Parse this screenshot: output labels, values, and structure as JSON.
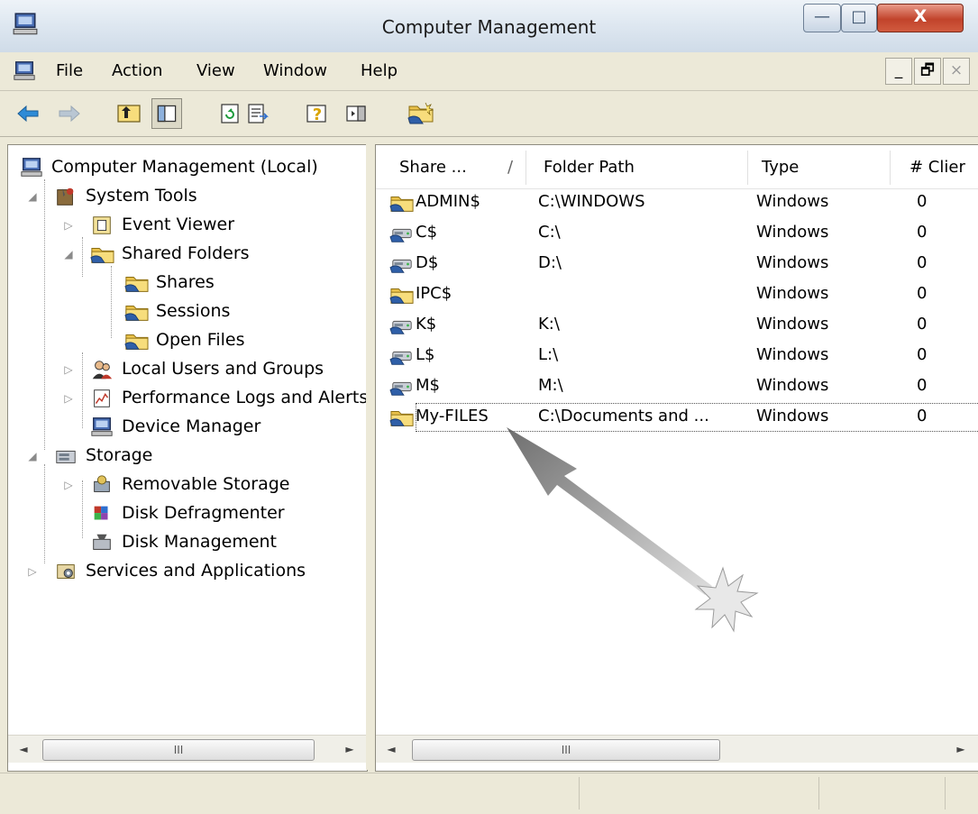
{
  "window": {
    "title": "Computer Management",
    "caption_buttons": {
      "minimize": "—",
      "maximize": "□",
      "close": "X"
    }
  },
  "menu": {
    "items": [
      {
        "label": "File"
      },
      {
        "label": "Action"
      },
      {
        "label": "View"
      },
      {
        "label": "Window"
      },
      {
        "label": "Help"
      }
    ],
    "mdi_buttons": {
      "minimize": "_",
      "restore": "🗗",
      "close": "×"
    }
  },
  "toolbar": {
    "buttons": [
      "back-arrow-icon",
      "forward-arrow-icon",
      "up-one-level-icon",
      "show-hide-console-tree-icon",
      "refresh-icon",
      "export-list-icon",
      "help-icon",
      "show-hide-action-pane-icon",
      "share-wizard-icon"
    ]
  },
  "tree": {
    "items": [
      {
        "label": "Computer Management (Local)",
        "icon": "computer-icon"
      },
      {
        "label": "System Tools",
        "icon": "tools-icon"
      },
      {
        "label": "Event Viewer",
        "icon": "event-viewer-icon"
      },
      {
        "label": "Shared Folders",
        "icon": "shared-folder-icon"
      },
      {
        "label": "Shares",
        "icon": "shared-folder-icon"
      },
      {
        "label": "Sessions",
        "icon": "shared-folder-icon"
      },
      {
        "label": "Open Files",
        "icon": "shared-folder-icon"
      },
      {
        "label": "Local Users and Groups",
        "icon": "users-icon"
      },
      {
        "label": "Performance Logs and Alerts",
        "icon": "performance-icon"
      },
      {
        "label": "Device Manager",
        "icon": "device-manager-icon"
      },
      {
        "label": "Storage",
        "icon": "storage-icon"
      },
      {
        "label": "Removable Storage",
        "icon": "removable-storage-icon"
      },
      {
        "label": "Disk Defragmenter",
        "icon": "defragmenter-icon"
      },
      {
        "label": "Disk Management",
        "icon": "disk-management-icon"
      },
      {
        "label": "Services and Applications",
        "icon": "services-icon"
      }
    ]
  },
  "list": {
    "columns": [
      "Share ...",
      "Folder Path",
      "Type",
      "# Clier"
    ],
    "sort_indicator": "/",
    "rows": [
      {
        "name": "ADMIN$",
        "path": "C:\\WINDOWS",
        "type": "Windows",
        "clients": "0",
        "icon": "folder-share-icon"
      },
      {
        "name": "C$",
        "path": "C:\\",
        "type": "Windows",
        "clients": "0",
        "icon": "drive-share-icon"
      },
      {
        "name": "D$",
        "path": "D:\\",
        "type": "Windows",
        "clients": "0",
        "icon": "drive-share-icon"
      },
      {
        "name": "IPC$",
        "path": "",
        "type": "Windows",
        "clients": "0",
        "icon": "folder-share-icon"
      },
      {
        "name": "K$",
        "path": "K:\\",
        "type": "Windows",
        "clients": "0",
        "icon": "drive-share-icon"
      },
      {
        "name": "L$",
        "path": "L:\\",
        "type": "Windows",
        "clients": "0",
        "icon": "drive-share-icon"
      },
      {
        "name": "M$",
        "path": "M:\\",
        "type": "Windows",
        "clients": "0",
        "icon": "drive-share-icon"
      },
      {
        "name": "My-FILES",
        "path": "C:\\Documents and ...",
        "type": "Windows",
        "clients": "0",
        "icon": "folder-share-icon"
      }
    ]
  },
  "scrollbars": {
    "thumb_grip": "III",
    "left_arrow": "◄",
    "right_arrow": "►"
  },
  "colors": {
    "chrome": "#ece9d8",
    "close_button": "#c1432b",
    "folder_yellow": "#f3d36b"
  }
}
